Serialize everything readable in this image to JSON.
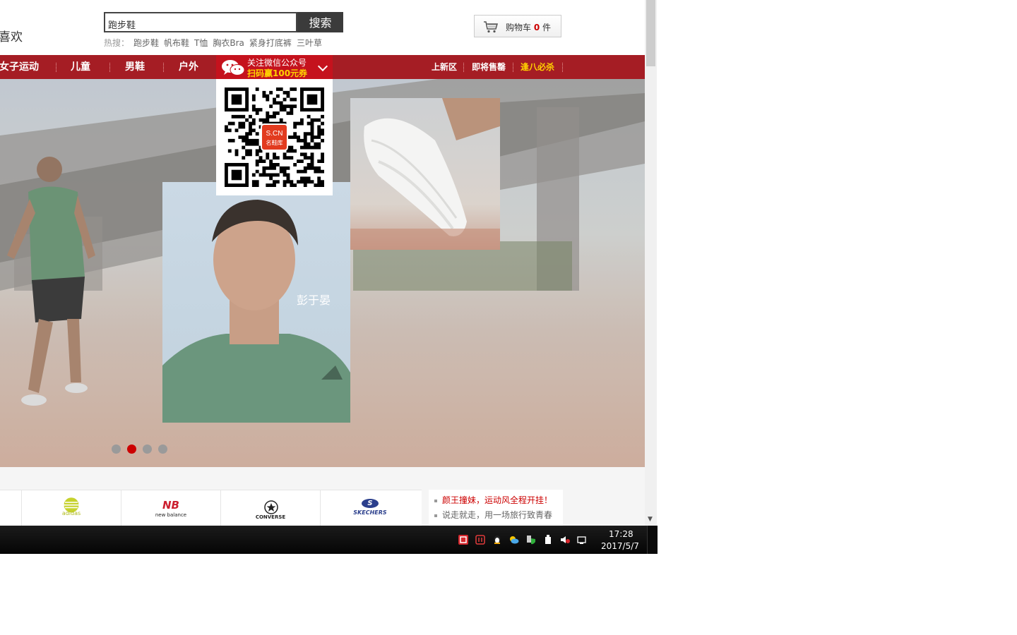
{
  "header": {
    "logo_fragment": "喜欢",
    "search": {
      "value": "跑步鞋",
      "button": "搜索"
    },
    "hot_label": "热搜：",
    "hot_items": [
      "跑步鞋",
      "帆布鞋",
      "T恤",
      "胸衣Bra",
      "紧身打底裤",
      "三叶草"
    ],
    "cart": {
      "label": "购物车",
      "count": "0",
      "unit": "件"
    }
  },
  "nav": {
    "items": [
      "女子运动",
      "儿童",
      "男鞋",
      "户外"
    ],
    "right_items": [
      "上新区",
      "即将售罄",
      "逢八必杀"
    ],
    "highlight_color": "#ffd200",
    "bar_color": "#a51d24"
  },
  "wechat": {
    "line1": "关注微信公众号",
    "line2": "扫码赢100元券",
    "qr_badge_top": "S.CN",
    "qr_badge_bottom": "名鞋库"
  },
  "banner": {
    "portrait_caption": "彭于晏",
    "shirt_logo": "adidas",
    "slides_total": 4,
    "active_slide": 2
  },
  "brands": [
    {
      "logo": "adidas",
      "name": ""
    },
    {
      "logo": "new balance",
      "name": ""
    },
    {
      "logo": "CONVERSE",
      "name": ""
    },
    {
      "logo": "SKECHERS",
      "name": ""
    }
  ],
  "news": [
    {
      "text": "颜王撞妹，运动风全程开挂！",
      "color": "#cc0000"
    },
    {
      "text": "说走就走，用一场旅行致青春",
      "color": "#666666"
    }
  ],
  "taskbar": {
    "time": "17:28",
    "date": "2017/5/7"
  }
}
